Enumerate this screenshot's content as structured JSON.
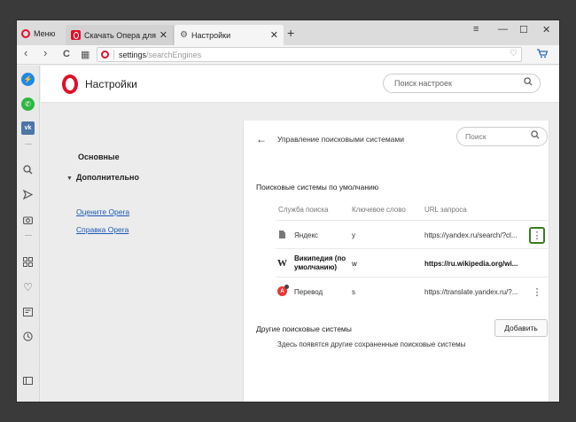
{
  "tabstrip": {
    "menu_label": "Меню",
    "tabs": [
      {
        "title": "Скачать Опера для компь",
        "close": "✕"
      },
      {
        "title": "Настройки",
        "close": "✕"
      }
    ],
    "new_tab": "+",
    "controls": {
      "filter": "⩸",
      "minimize": "—",
      "maximize": "☐",
      "close": "✕"
    }
  },
  "addressbar": {
    "back": "‹",
    "forward": "›",
    "reload": "C",
    "speed_dial": "▦",
    "url_host": "settings",
    "url_path": "/searchEngines",
    "heart": "♡",
    "cart": "🛒"
  },
  "sidebar": {
    "icons": [
      "messenger-icon",
      "whatsapp-icon",
      "vk-icon",
      "search-icon",
      "send-icon",
      "camera-icon",
      "speed-dial-icon",
      "heart-icon",
      "news-icon",
      "history-icon",
      "panel-icon"
    ]
  },
  "settings": {
    "title": "Настройки",
    "search_placeholder": "Поиск настроек",
    "nav": {
      "basic": "Основные",
      "advanced": "Дополнительно",
      "rate": "Оцените Opera",
      "help": "Справка Opera"
    }
  },
  "search_engines": {
    "title": "Управление поисковыми системами",
    "search_placeholder": "Поиск",
    "default_section": "Поисковые системы по умолчанию",
    "columns": {
      "service": "Служба поиска",
      "keyword": "Ключевое слово",
      "url": "URL запроса"
    },
    "rows": [
      {
        "name": "Яндекс",
        "keyword": "y",
        "url": "https://yandex.ru/search/?cl...",
        "icon": "document-icon"
      },
      {
        "name": "Википедия (по умолчанию)",
        "name_line1": "Википедия (по",
        "name_line2": "умолчанию)",
        "keyword": "w",
        "url": "https://ru.wikipedia.org/wi...",
        "icon": "wikipedia-icon"
      },
      {
        "name": "Перевод",
        "keyword": "s",
        "url": "https://translate.yandex.ru/?...",
        "icon": "translate-icon"
      }
    ],
    "other_section": "Другие поисковые системы",
    "add_button": "Добавить",
    "other_note": "Здесь появятся другие сохраненные поисковые системы"
  },
  "colors": {
    "opera_red": "#e0102a",
    "link": "#1b58b8",
    "highlight": "#3a7d1e"
  }
}
